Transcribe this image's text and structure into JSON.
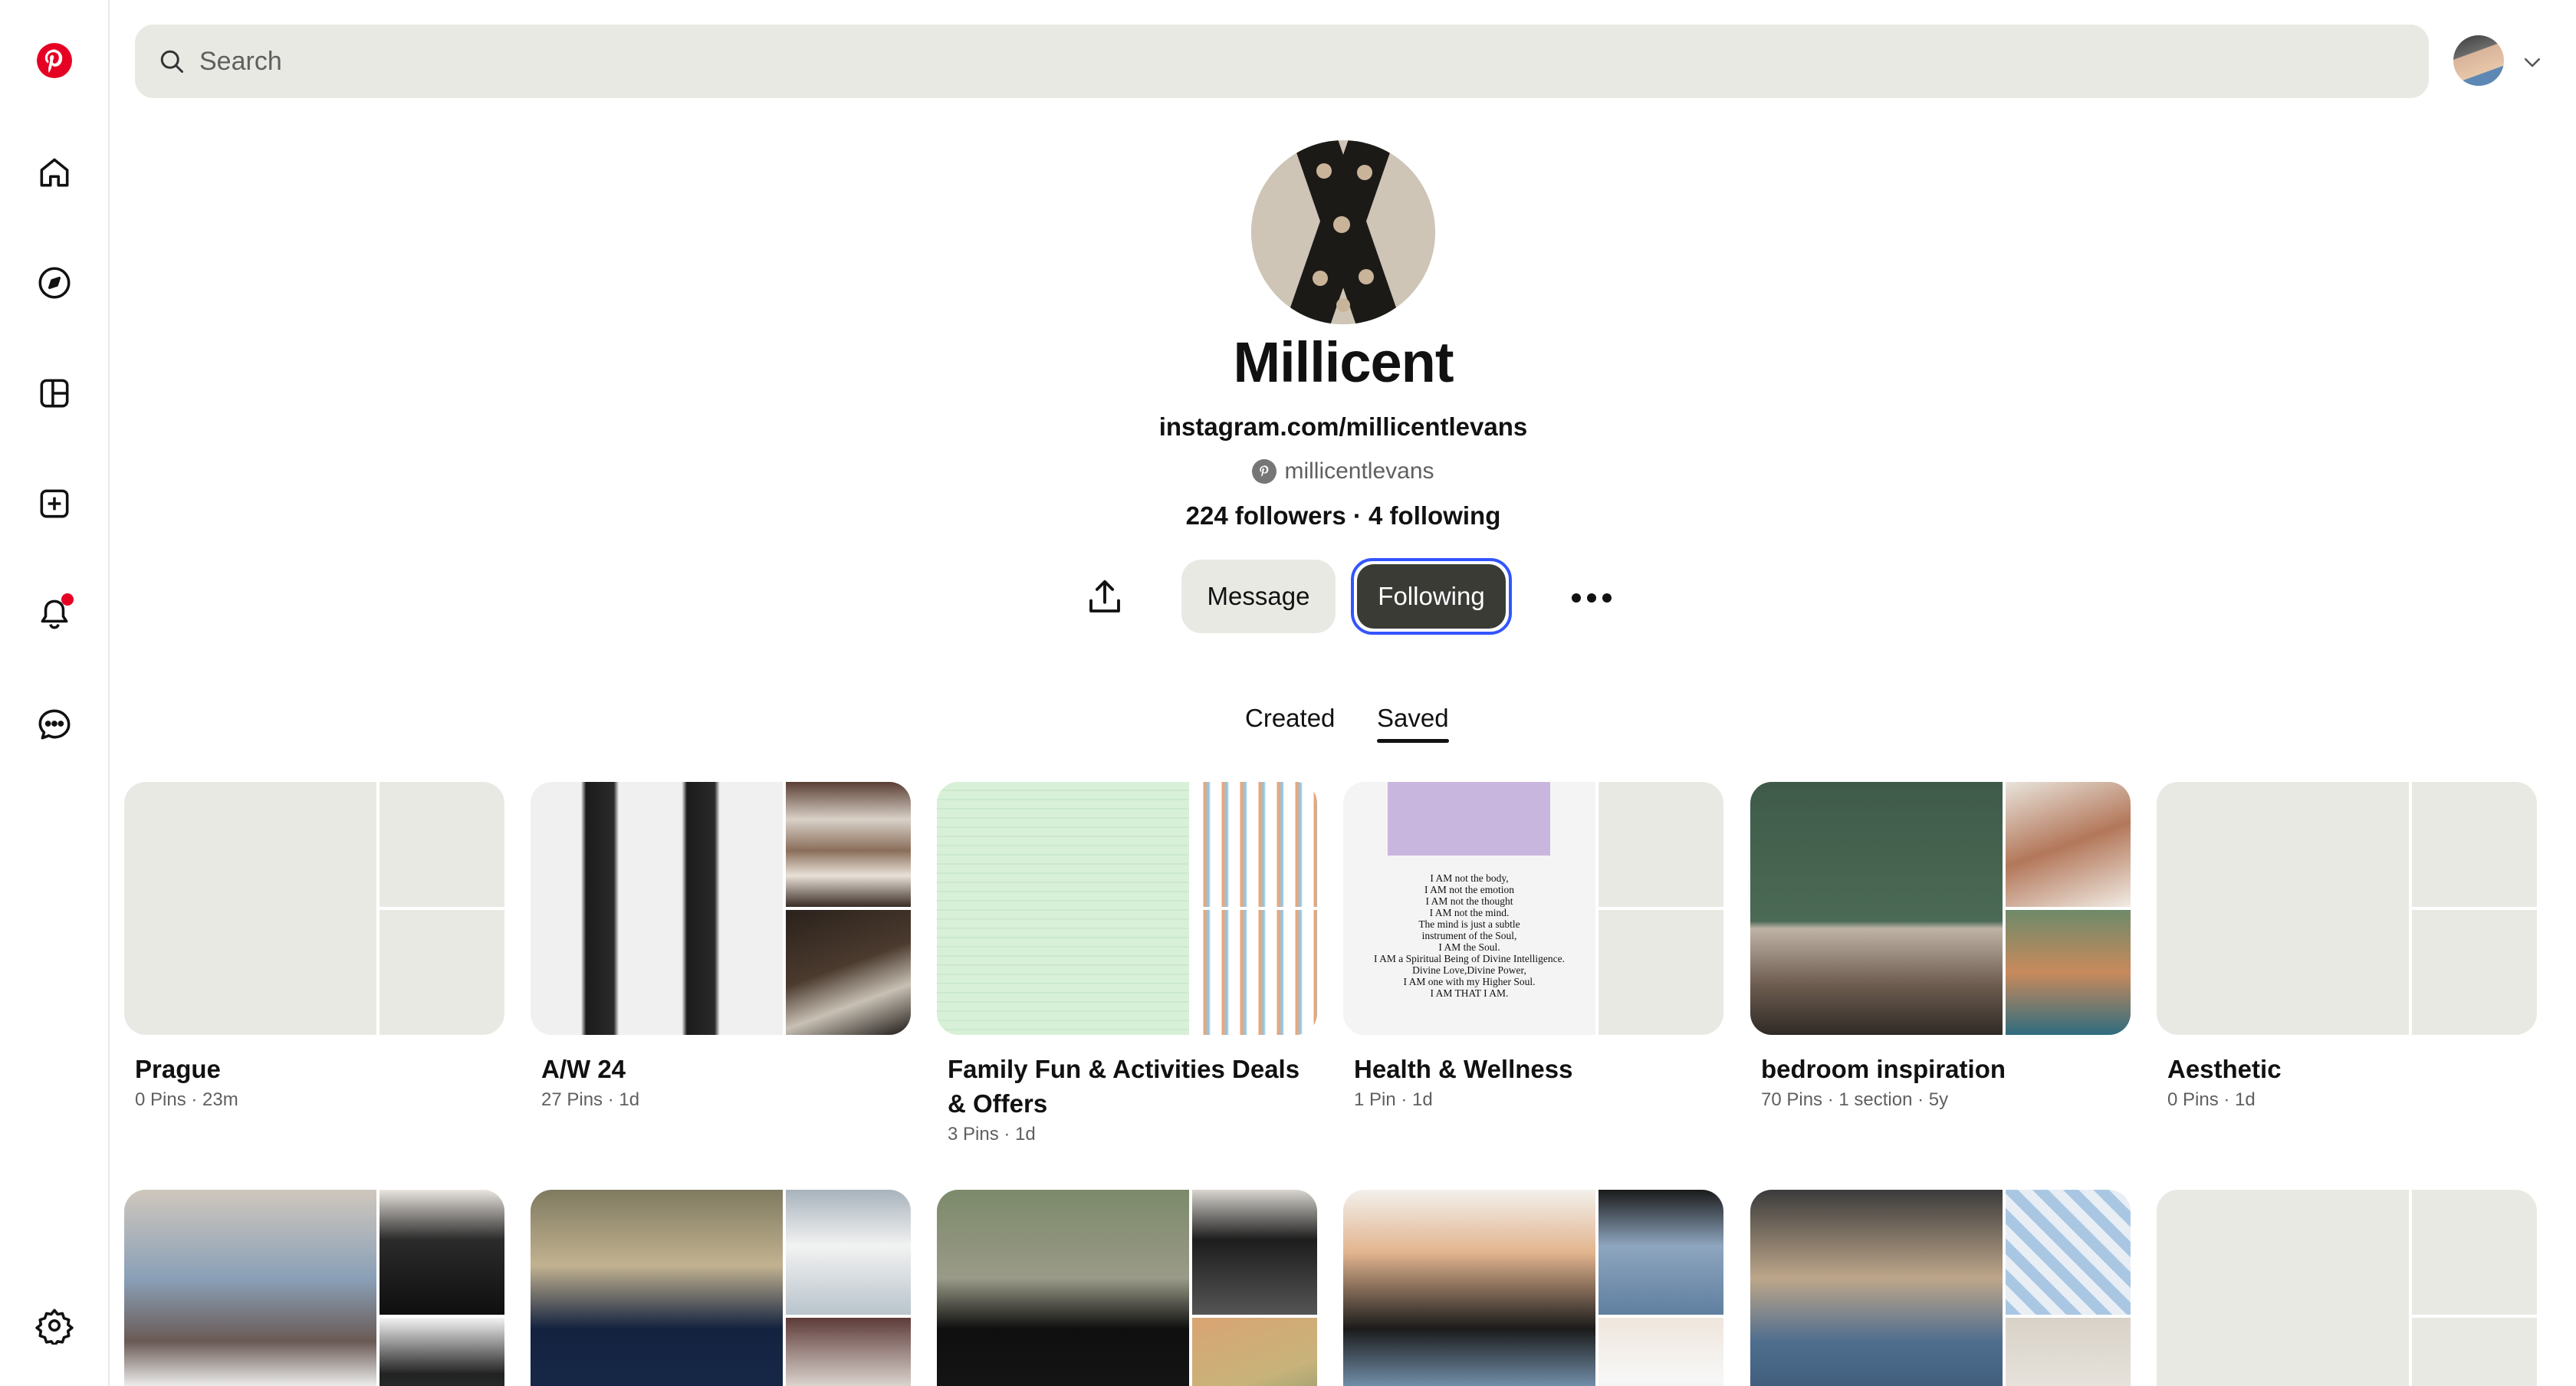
{
  "search": {
    "placeholder": "Search"
  },
  "profile": {
    "name": "Millicent",
    "link": "instagram.com/millicentlevans",
    "handle": "millicentlevans",
    "stats": "224 followers · 4 following"
  },
  "actions": {
    "message_label": "Message",
    "following_label": "Following"
  },
  "tabs": {
    "created": "Created",
    "saved": "Saved"
  },
  "boards": [
    {
      "title": "Prague",
      "meta": "0 Pins · 23m"
    },
    {
      "title": "A/W 24",
      "meta": "27 Pins · 1d"
    },
    {
      "title": "Family Fun & Activities Deals & Offers",
      "meta": "3 Pins · 1d"
    },
    {
      "title": "Health & Wellness",
      "meta": "1 Pin · 1d"
    },
    {
      "title": "bedroom inspiration",
      "meta": "70 Pins · 1 section · 5y"
    },
    {
      "title": "Aesthetic",
      "meta": "0 Pins · 1d"
    }
  ],
  "health_quote": [
    "I AM not the body,",
    "I AM not the emotion",
    "I AM not the thought",
    "I AM not the mind.",
    "The mind is just a subtle",
    "instrument of the Soul,",
    "I AM the Soul.",
    "I AM a Spiritual Being of Divine Intelligence.",
    "Divine Love,Divine Power,",
    "I AM one with my Higher Soul.",
    "I AM THAT I AM."
  ],
  "brand_color": "#e60023",
  "icons": [
    "pinterest-logo-icon",
    "home-icon",
    "explore-icon",
    "boards-icon",
    "create-icon",
    "notifications-icon",
    "messages-icon",
    "settings-icon",
    "search-icon",
    "share-icon",
    "more-icon",
    "chevron-down-icon"
  ]
}
